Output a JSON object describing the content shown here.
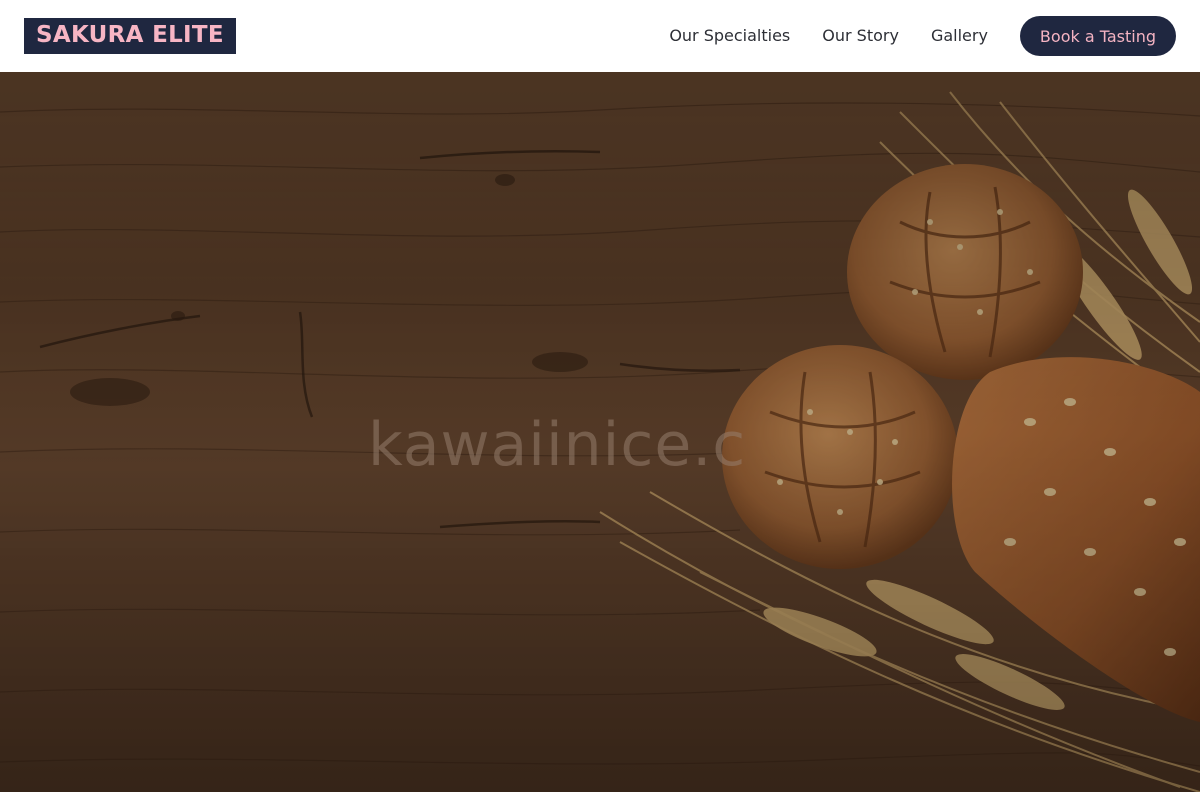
{
  "header": {
    "logo_text": "SAKURA ELITE",
    "nav": [
      {
        "label": "Our Specialties"
      },
      {
        "label": "Our Story"
      },
      {
        "label": "Gallery"
      }
    ],
    "cta_label": "Book a Tasting"
  },
  "hero": {
    "watermark_text": "kawaiinice.c",
    "image_subject": "bread loaves and wheat on wooden table"
  },
  "colors": {
    "brand_navy": "#1f2740",
    "brand_pink": "#f7b5c4",
    "wood": "#5d3f29"
  }
}
